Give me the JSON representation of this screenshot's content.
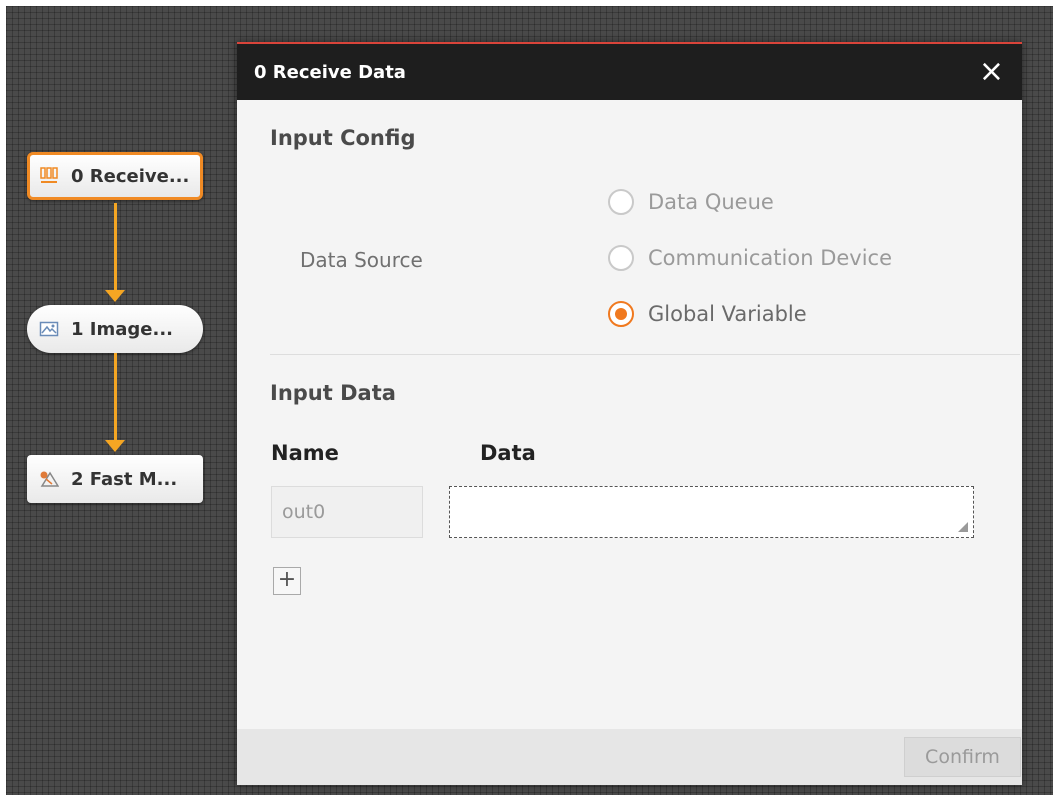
{
  "nodes": [
    {
      "label": "0 Receive...",
      "icon": "receive-data-icon"
    },
    {
      "label": "1 Image...",
      "icon": "image-icon"
    },
    {
      "label": "2 Fast M...",
      "icon": "fast-match-icon"
    }
  ],
  "colors": {
    "accent": "#f0791f",
    "connector": "#f5a623",
    "title_bar": "#1e1e1e",
    "dialog_top_border": "#d9443a"
  },
  "dialog": {
    "title": "0 Receive Data",
    "close_icon": "×",
    "input_config": {
      "heading": "Input Config",
      "data_source_label": "Data Source",
      "options": [
        "Data Queue",
        "Communication Device",
        "Global Variable"
      ],
      "selected": "Global Variable"
    },
    "input_data": {
      "heading": "Input Data",
      "name_header": "Name",
      "data_header": "Data",
      "row": {
        "name": "out0",
        "data": ""
      },
      "add_label": "+"
    },
    "confirm_label": "Confirm"
  }
}
